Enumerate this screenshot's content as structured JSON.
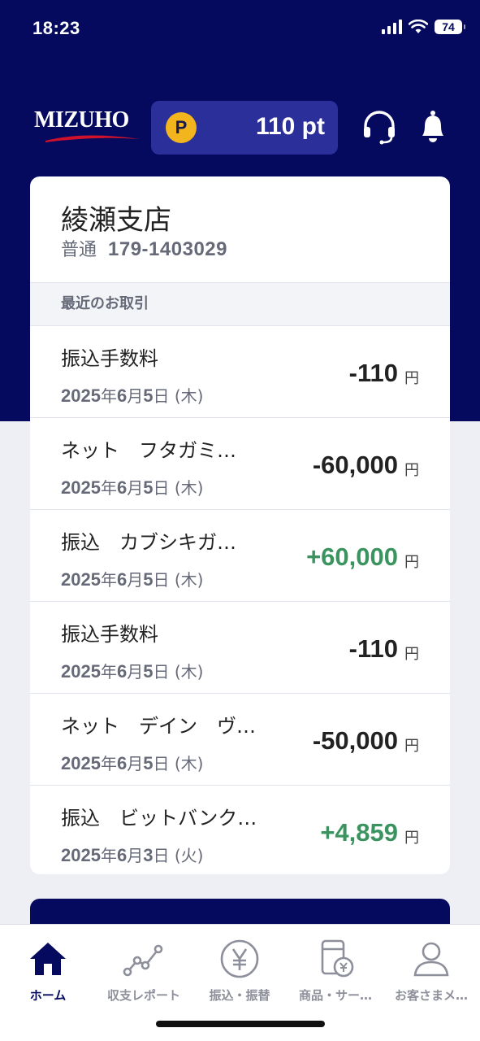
{
  "status_bar": {
    "time": "18:23",
    "battery": "74"
  },
  "header": {
    "logo_text": "MIZUHO",
    "points_icon_letter": "P",
    "points_value": "110 pt",
    "icons": [
      "headset-icon",
      "bell-icon"
    ]
  },
  "account": {
    "branch_name": "綾瀬支店",
    "type": "普通",
    "number": "179-1403029"
  },
  "recent_header": "最近のお取引",
  "transactions": [
    {
      "description": "振込手数料",
      "year": "2025",
      "month": "6",
      "day": "5",
      "weekday": "(木)",
      "amount": "-110",
      "currency": "円",
      "sign": "neg"
    },
    {
      "description": "ネット　フタガミ…",
      "year": "2025",
      "month": "6",
      "day": "5",
      "weekday": "(木)",
      "amount": "-60,000",
      "currency": "円",
      "sign": "neg"
    },
    {
      "description": "振込　カブシキガ…",
      "year": "2025",
      "month": "6",
      "day": "5",
      "weekday": "(木)",
      "amount": "+60,000",
      "currency": "円",
      "sign": "pos"
    },
    {
      "description": "振込手数料",
      "year": "2025",
      "month": "6",
      "day": "5",
      "weekday": "(木)",
      "amount": "-110",
      "currency": "円",
      "sign": "neg"
    },
    {
      "description": "ネット　デイン　ヴ…",
      "year": "2025",
      "month": "6",
      "day": "5",
      "weekday": "(木)",
      "amount": "-50,000",
      "currency": "円",
      "sign": "neg"
    },
    {
      "description": "振込　ビットバンク…",
      "year": "2025",
      "month": "6",
      "day": "3",
      "weekday": "(火)",
      "amount": "+4,859",
      "currency": "円",
      "sign": "pos"
    }
  ],
  "date_units": {
    "year": "年",
    "month": "月",
    "day": "日"
  },
  "colors": {
    "brand_navy": "#060a5e",
    "positive": "#3b9460",
    "points_coin": "#f2b51d"
  },
  "bottom_nav": [
    {
      "label": "ホーム",
      "icon": "home-icon",
      "active": true
    },
    {
      "label": "収支レポート",
      "icon": "chart-line-icon",
      "active": false
    },
    {
      "label": "振込・振替",
      "icon": "yen-coin-icon",
      "active": false
    },
    {
      "label": "商品・サー…",
      "icon": "products-icon",
      "active": false
    },
    {
      "label": "お客さまメ…",
      "icon": "person-icon",
      "active": false
    }
  ]
}
